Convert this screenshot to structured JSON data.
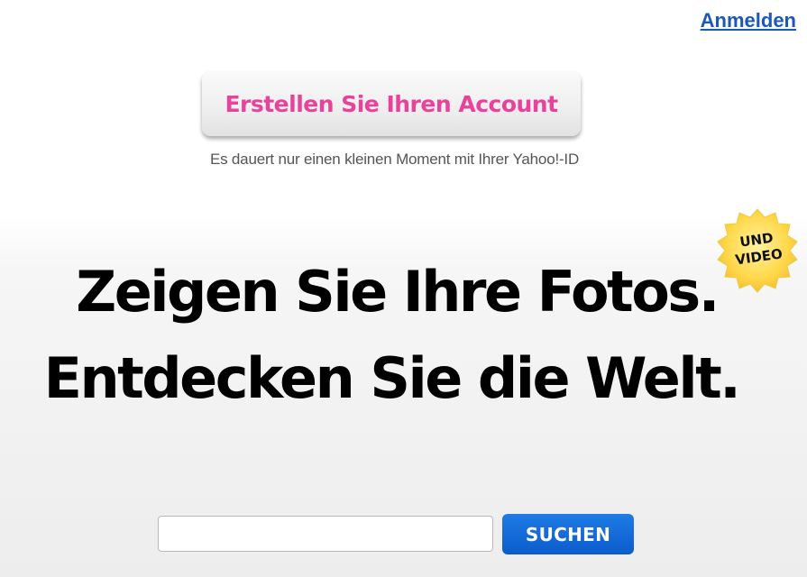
{
  "header": {
    "signin_label": "Anmelden"
  },
  "signup": {
    "button_label": "Erstellen Sie Ihren Account",
    "subtext": "Es dauert nur einen kleinen Moment mit Ihrer Yahoo!-ID"
  },
  "hero": {
    "line1": "Zeigen Sie Ihre Fotos.",
    "line2": "Entdecken Sie die Welt.",
    "badge_line1": "UND",
    "badge_line2": "VIDEO"
  },
  "search": {
    "value": "",
    "placeholder": "",
    "button_label": "SUCHEN"
  },
  "colors": {
    "link": "#1b58b8",
    "signup_text": "#e8439a",
    "search_button": "#0a5ccc",
    "badge": "#ffd84a"
  }
}
